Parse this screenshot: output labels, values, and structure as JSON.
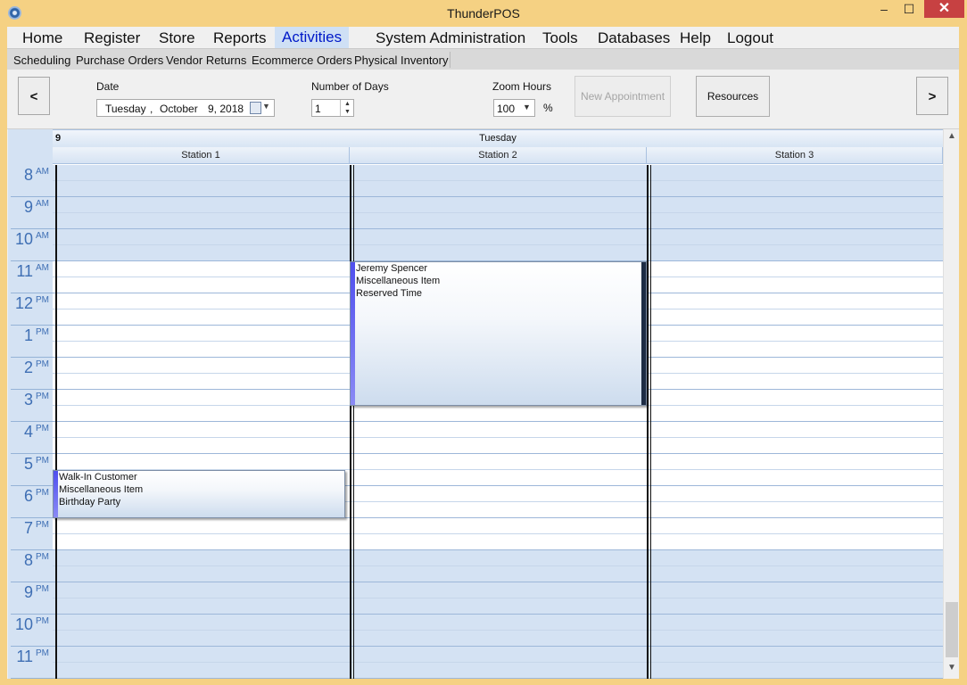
{
  "window": {
    "title": "ThunderPOS",
    "min": "–",
    "max": "☐",
    "close": "✕"
  },
  "menu": {
    "items": [
      "Home",
      "Register",
      "Store",
      "Reports",
      "Activities",
      "System Administration",
      "Tools",
      "Databases",
      "Help",
      "Logout"
    ],
    "active": "Activities"
  },
  "submenu": {
    "items": [
      "Scheduling",
      "Purchase Orders",
      "Vendor Returns",
      "Ecommerce Orders",
      "Physical Inventory"
    ]
  },
  "toolbar": {
    "prev": "<",
    "next": ">",
    "date_label": "Date",
    "date_weekday": "Tuesday",
    "date_sep": ",",
    "date_month": "October",
    "date_day_year": "9, 2018",
    "days_label": "Number of Days",
    "days_value": "1",
    "zoom_label": "Zoom Hours",
    "zoom_value": "100",
    "zoom_unit": "%",
    "new_appointment": "New Appointment",
    "resources": "Resources"
  },
  "schedule": {
    "day_number": "9",
    "day_name": "Tuesday",
    "stations": [
      "Station 1",
      "Station 2",
      "Station 3"
    ],
    "hours": [
      {
        "num": "8",
        "ampm": "AM"
      },
      {
        "num": "9",
        "ampm": "AM"
      },
      {
        "num": "10",
        "ampm": "AM"
      },
      {
        "num": "11",
        "ampm": "AM"
      },
      {
        "num": "12",
        "ampm": "PM"
      },
      {
        "num": "1",
        "ampm": "PM"
      },
      {
        "num": "2",
        "ampm": "PM"
      },
      {
        "num": "3",
        "ampm": "PM"
      },
      {
        "num": "4",
        "ampm": "PM"
      },
      {
        "num": "5",
        "ampm": "PM"
      },
      {
        "num": "6",
        "ampm": "PM"
      },
      {
        "num": "7",
        "ampm": "PM"
      },
      {
        "num": "8",
        "ampm": "PM"
      },
      {
        "num": "9",
        "ampm": "PM"
      },
      {
        "num": "10",
        "ampm": "PM"
      },
      {
        "num": "11",
        "ampm": "PM"
      }
    ],
    "appointments": [
      {
        "station": "Station 2",
        "customer": "Jeremy Spencer",
        "item": "Miscellaneous Item",
        "description": "Reserved Time",
        "start": "11:00 AM",
        "end": "3:30 PM"
      },
      {
        "station": "Station 1",
        "customer": "Walk-In Customer",
        "item": "Miscellaneous Item",
        "description": "Birthday Party",
        "start": "5:30 PM",
        "end": "7:00 PM"
      }
    ]
  },
  "colors": {
    "accent": "#0019c8",
    "gutter": "#d4e2f3",
    "appointment_bar": "#5050ee"
  }
}
